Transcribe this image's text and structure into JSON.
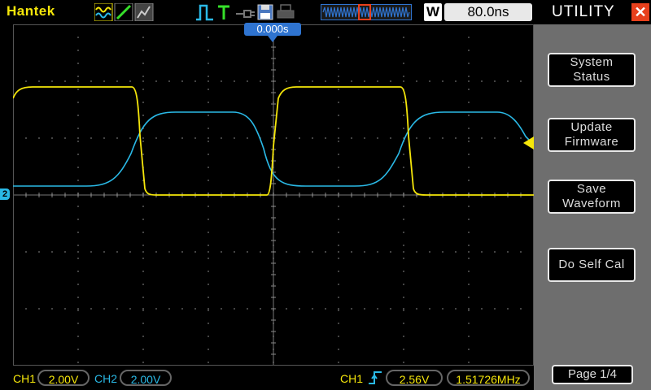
{
  "header": {
    "brand": "Hantek",
    "memory_icon": "W",
    "timebase": "80.0ns"
  },
  "screen": {
    "trigger_position": "0.000s",
    "ch2_marker": "2"
  },
  "footer": {
    "ch1_label": "CH1",
    "ch1_scale": "2.00V",
    "ch2_label": "CH2",
    "ch2_scale": "2.00V",
    "trigger_source": "CH1",
    "trigger_level": "2.56V",
    "frequency": "1.51726MHz"
  },
  "panel": {
    "title": "UTILITY",
    "buttons": [
      {
        "line1": "System",
        "line2": "Status"
      },
      {
        "line1": "Update",
        "line2": "Firmware"
      },
      {
        "line1": "Save",
        "line2": "Waveform"
      },
      {
        "line1": "Do Self Cal",
        "line2": ""
      }
    ],
    "page": "Page 1/4"
  },
  "colors": {
    "ch1": "#f5e60a",
    "ch2": "#2ab9e6",
    "accent": "#2f74d0",
    "close": "#e8401c"
  },
  "icons": [
    "wave-mode-icon",
    "edge-icon",
    "persistence-icon",
    "pulse-icon",
    "trigger-icon",
    "probe-icon",
    "save-icon",
    "print-icon"
  ]
}
